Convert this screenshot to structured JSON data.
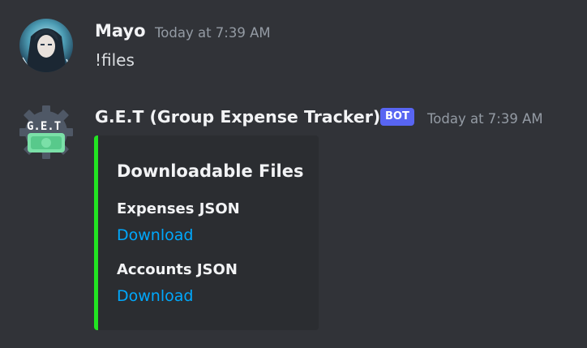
{
  "messages": [
    {
      "username": "Mayo",
      "timestamp": "Today at 7:39 AM",
      "text": "!files"
    },
    {
      "username": "G.E.T (Group Expense Tracker)",
      "badge": "BOT",
      "timestamp": "Today at 7:39 AM",
      "avatar_text": "G.E.T",
      "embed": {
        "accent_color": "#22e422",
        "title": "Downloadable Files",
        "fields": [
          {
            "name": "Expenses JSON",
            "link": "Download"
          },
          {
            "name": "Accounts JSON",
            "link": "Download"
          }
        ]
      }
    }
  ],
  "colors": {
    "background": "#313338",
    "embed_background": "#2b2d31",
    "link": "#00a8fc",
    "bot_badge": "#5865f2"
  }
}
